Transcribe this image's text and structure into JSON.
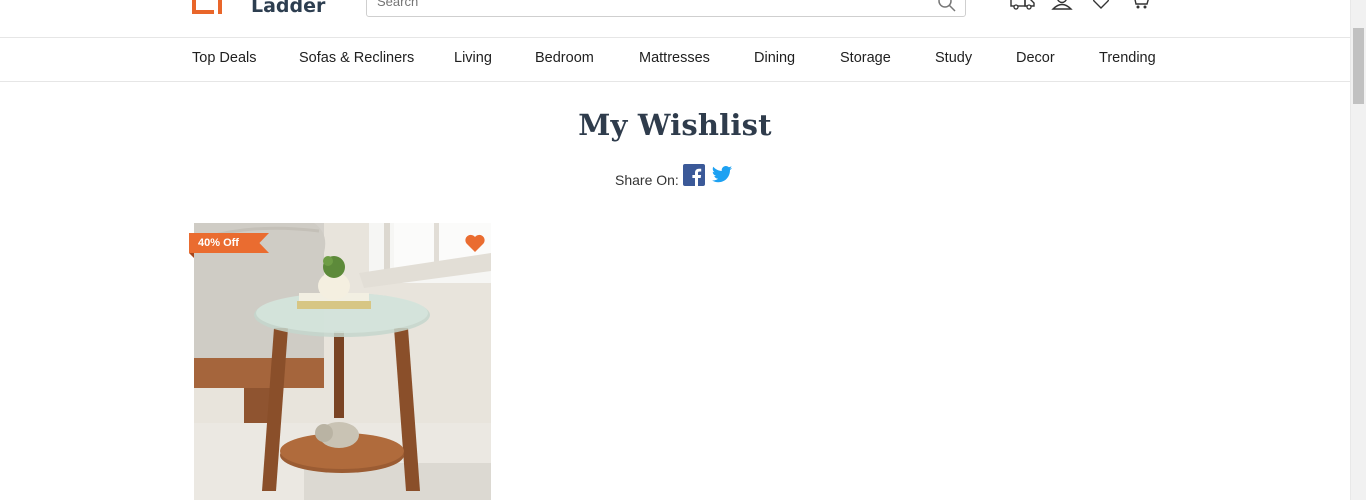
{
  "header": {
    "logo_text": "Ladder",
    "search_placeholder": "Search"
  },
  "nav": {
    "items": [
      "Top Deals",
      "Sofas & Recliners",
      "Living",
      "Bedroom",
      "Mattresses",
      "Dining",
      "Storage",
      "Study",
      "Decor",
      "Trending"
    ]
  },
  "main": {
    "title": "My Wishlist",
    "share_label": "Share On:"
  },
  "product": {
    "discount_badge": "40% Off"
  },
  "colors": {
    "accent": "#ea6c30",
    "title": "#2f3c4c",
    "facebook": "#3b5998",
    "twitter": "#1da1f2"
  }
}
